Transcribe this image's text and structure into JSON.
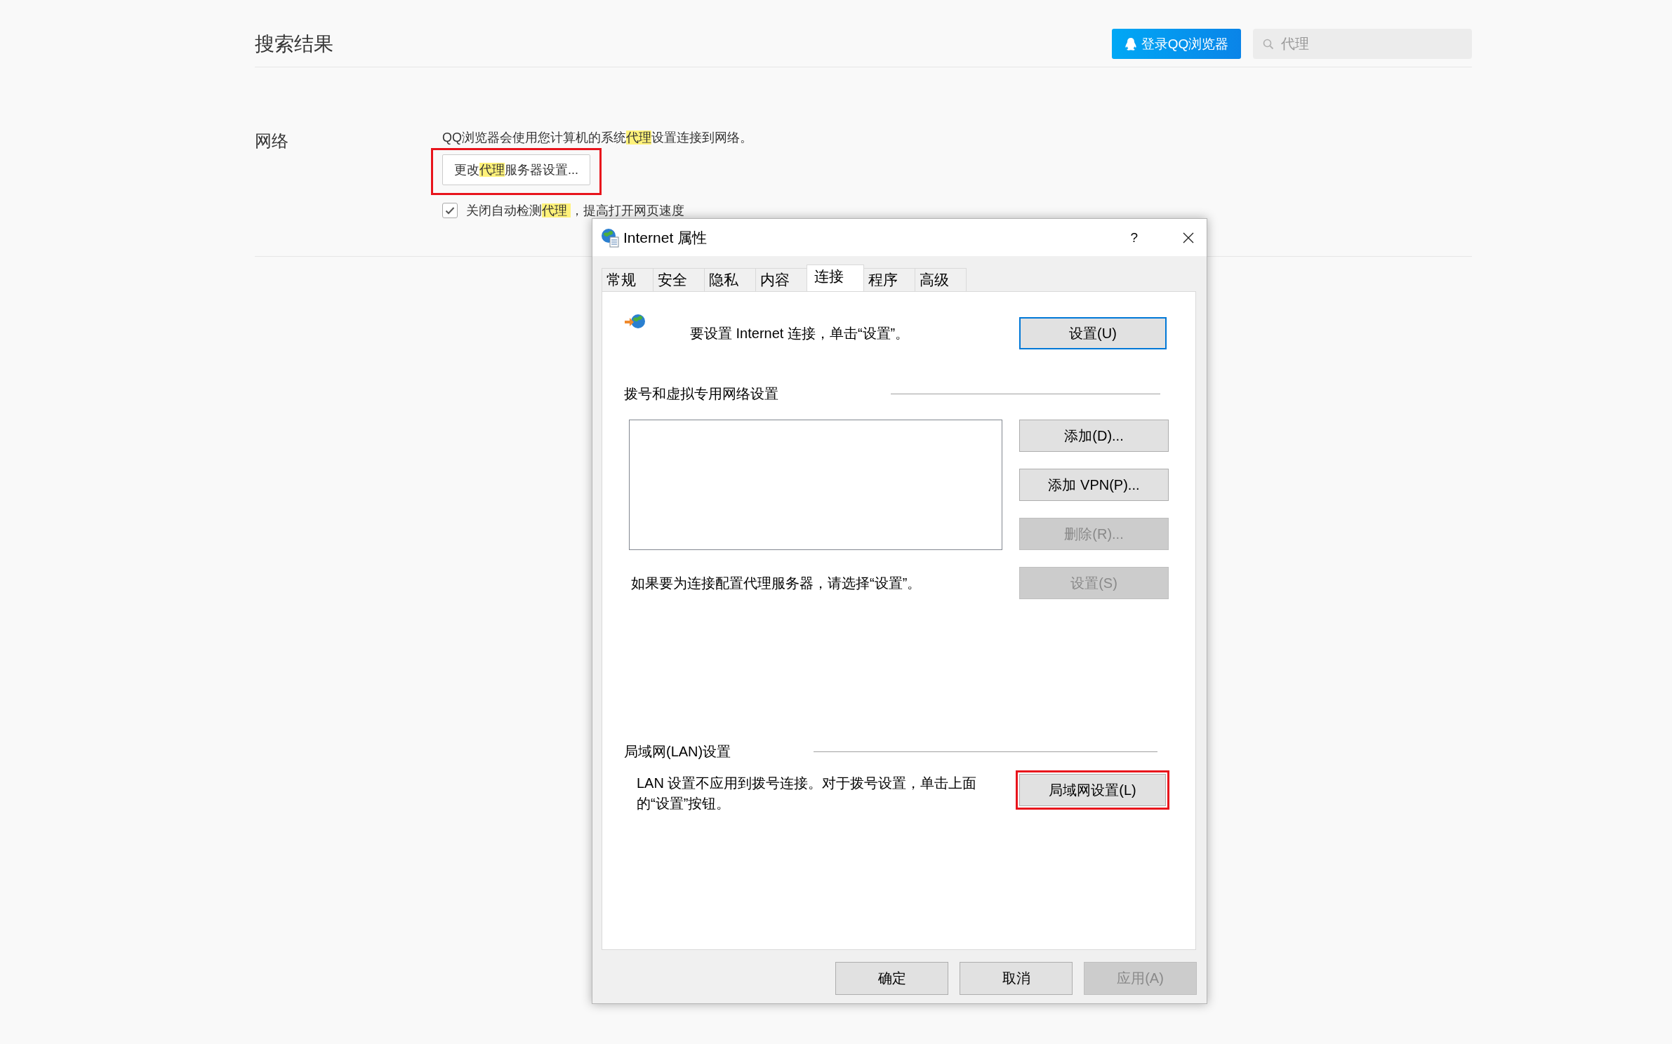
{
  "header": {
    "title": "搜索结果",
    "login_button": "登录QQ浏览器",
    "search": {
      "value": "代理"
    }
  },
  "section": {
    "label": "网络",
    "description": [
      {
        "text": "QQ浏览器会使用您计算机的系统",
        "highlight": false
      },
      {
        "text": "代理",
        "highlight": true
      },
      {
        "text": "设置连接到网络。",
        "highlight": false
      }
    ],
    "button": {
      "marked": true,
      "label": [
        {
          "text": "更改",
          "highlight": false
        },
        {
          "text": "代理",
          "highlight": true
        },
        {
          "text": "服务器设置...",
          "highlight": false
        }
      ]
    },
    "checkbox": {
      "checked": true,
      "label": [
        {
          "text": "关闭自动检测",
          "highlight": false
        },
        {
          "text": "代理  ",
          "highlight": true
        },
        {
          "text": "，提高打开网页速度",
          "highlight": false
        }
      ]
    }
  },
  "dialog": {
    "title": "Internet 属性",
    "help": "?",
    "tabs": [
      {
        "label": "常规",
        "selected": false
      },
      {
        "label": "安全",
        "selected": false
      },
      {
        "label": "隐私",
        "selected": false
      },
      {
        "label": "内容",
        "selected": false
      },
      {
        "label": "连接",
        "selected": true
      },
      {
        "label": "程序",
        "selected": false
      },
      {
        "label": "高级",
        "selected": false
      }
    ],
    "setup": {
      "text": "要设置 Internet 连接，单击“设置”。",
      "button": {
        "label": "设置(U)",
        "focused": true
      }
    },
    "dialup": {
      "heading": "拨号和虚拟专用网络设置",
      "buttons": [
        {
          "label": "添加(D)...",
          "disabled": false
        },
        {
          "label": "添加 VPN(P)...",
          "disabled": false
        },
        {
          "label": "删除(R)...",
          "disabled": true
        },
        {
          "label": "设置(S)",
          "disabled": true
        }
      ],
      "note": "如果要为连接配置代理服务器，请选择“设置”。"
    },
    "lan": {
      "heading": "局域网(LAN)设置",
      "text": "LAN 设置不应用到拨号连接。对于拨号设置，单击上面的“设置”按钮。",
      "button": {
        "label": "局域网设置(L)",
        "marked": true
      }
    },
    "footer_buttons": [
      {
        "label": "确定",
        "disabled": false
      },
      {
        "label": "取消",
        "disabled": false
      },
      {
        "label": "应用(A)",
        "disabled": true
      }
    ]
  }
}
